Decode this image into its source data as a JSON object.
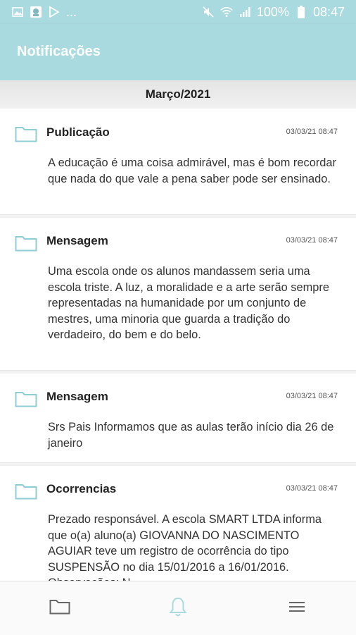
{
  "status_bar": {
    "battery": "100%",
    "time": "08:47",
    "more": "..."
  },
  "app_bar": {
    "title": "Notificações"
  },
  "month_header": "Março/2021",
  "notifications": [
    {
      "icon": "folder-icon",
      "title": "Publicação",
      "time": "03/03/21 08:47",
      "body": "A educação é uma coisa admirável, mas é bom recordar que nada do que vale a pena saber pode ser ensinado."
    },
    {
      "icon": "folder-icon",
      "title": "Mensagem",
      "time": "03/03/21 08:47",
      "body": "Uma escola onde os alunos mandassem seria uma escola triste. A luz, a moralidade e a arte serão sempre representadas na humanidade por um conjunto de mestres, uma minoria que guarda a tradição do verdadeiro, do bem e do belo."
    },
    {
      "icon": "folder-icon",
      "title": "Mensagem",
      "time": "03/03/21 08:47",
      "body": "Srs Pais Informamos que as aulas terão início dia 26 de janeiro"
    },
    {
      "icon": "folder-icon",
      "title": "Ocorrencias",
      "time": "03/03/21 08:47",
      "body": "Prezado responsável. A escola SMART LTDA informa que o(a) aluno(a) GIOVANNA DO NASCIMENTO AGUIAR teve um registro de ocorrência do tipo SUSPENSÃO no dia 15/01/2016 a 16/01/2016. Observações: N"
    }
  ],
  "bottom_nav": {
    "items": [
      "folder-icon",
      "bell-icon",
      "menu-icon"
    ],
    "active": "bell-icon"
  },
  "colors": {
    "accent": "#a9dadf",
    "icon": "#8fcdd6",
    "card": "#ffffff",
    "background": "#f2f2f2"
  }
}
